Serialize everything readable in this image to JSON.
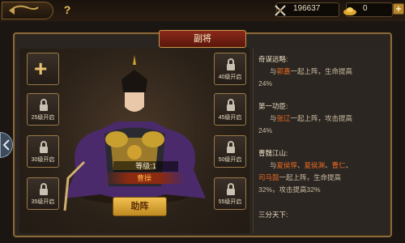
{
  "topbar": {
    "help_icon": "?",
    "resource1_value": "196637",
    "resource2_value": "0",
    "plus_label": "+"
  },
  "panel": {
    "title": "副将"
  },
  "slots": {
    "add_label": "+",
    "left": [
      "25级开启",
      "30级开启",
      "35级开启"
    ],
    "right": [
      "40级开启",
      "45级开启",
      "50级开启",
      "55级开启"
    ]
  },
  "hero": {
    "level": "等级:1",
    "name": "曹操"
  },
  "assist_button": "助阵",
  "info": {
    "s1_title": "奇谋远略:",
    "s1_a": "与",
    "s1_name": "郭嘉",
    "s1_b": "一起上阵，生命提高",
    "s1_c": "24%",
    "s2_title": "第一功臣:",
    "s2_a": "与",
    "s2_name": "张辽",
    "s2_b": "一起上阵，攻击提高",
    "s2_c": "24%",
    "s3_title": "曹魏江山:",
    "s3_a": "与",
    "s3_n1": "夏侯惇",
    "s3_n2": "夏侯渊",
    "s3_n3": "曹仁",
    "s3_sep": "、",
    "s3_n4": "司马懿",
    "s3_b": "一起上阵，生命提高",
    "s3_c": "32%，攻击提高32%",
    "s4_title": "三分天下:"
  },
  "colors": {
    "highlight": "#e86a20",
    "gold_button": "#e0b040",
    "title_red": "#8a2a1a"
  }
}
